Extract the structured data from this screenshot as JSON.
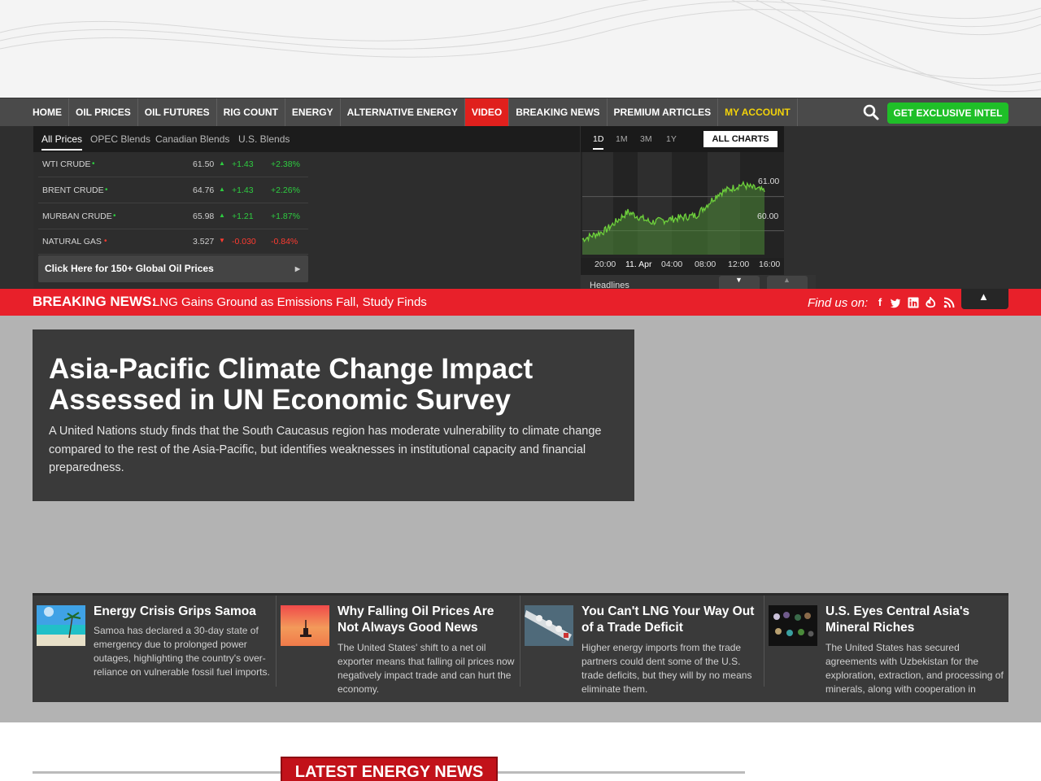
{
  "nav": {
    "items": [
      "HOME",
      "OIL PRICES",
      "OIL FUTURES",
      "RIG COUNT",
      "ENERGY",
      "ALTERNATIVE ENERGY",
      "VIDEO",
      "BREAKING NEWS",
      "PREMIUM ARTICLES",
      "MY ACCOUNT"
    ],
    "cta": "GET EXCLUSIVE INTEL"
  },
  "prices": {
    "tabs": [
      "All Prices",
      "OPEC Blends",
      "Canadian Blends",
      "U.S. Blends"
    ],
    "rows": [
      {
        "name": "WTI CRUDE",
        "last": "61.50",
        "change": "+1.43",
        "pct": "+2.38%",
        "dir": "up"
      },
      {
        "name": "BRENT CRUDE",
        "last": "64.76",
        "change": "+1.43",
        "pct": "+2.26%",
        "dir": "up"
      },
      {
        "name": "MURBAN CRUDE",
        "last": "65.98",
        "change": "+1.21",
        "pct": "+1.87%",
        "dir": "up"
      },
      {
        "name": "NATURAL GAS",
        "last": "3.527",
        "change": "-0.030",
        "pct": "-0.84%",
        "dir": "down"
      }
    ],
    "global_link": "Click Here for 150+ Global Oil Prices"
  },
  "chart": {
    "ranges": [
      "1D",
      "1M",
      "3M",
      "1Y"
    ],
    "all_charts": "ALL CHARTS",
    "y_ticks": [
      "61.00",
      "60.00"
    ],
    "x_labels": [
      "20:00",
      "11. Apr",
      "04:00",
      "08:00",
      "12:00",
      "16:00"
    ],
    "headlines_label": "Headlines"
  },
  "chart_data": {
    "type": "area",
    "x": [
      "20:00",
      "11. Apr",
      "04:00",
      "08:00",
      "12:00",
      "16:00"
    ],
    "series": [
      {
        "values": [
          59.75,
          60.0,
          60.55,
          60.25,
          60.35,
          60.45,
          61.1,
          61.35,
          61.15
        ]
      }
    ],
    "ylim": [
      59.3,
      62.3
    ]
  },
  "breaking": {
    "label": "BREAKING NEWS:",
    "headline": "LNG Gains Ground as Emissions Fall, Study Finds",
    "find_us": "Find us on:"
  },
  "hero": {
    "title": "Asia-Pacific Climate Change Impact Assessed in UN Economic Survey",
    "description": "A United Nations study finds that the South Caucasus region has moderate vulnerability to climate change compared to the rest of the Asia-Pacific, but identifies weaknesses in institutional capacity and financial preparedness."
  },
  "cards": [
    {
      "title": "Energy Crisis Grips Samoa",
      "description": "Samoa has declared a 30-day state of emergency due to prolonged power outages, highlighting the country's over-reliance on vulnerable fossil fuel imports."
    },
    {
      "title": "Why Falling Oil Prices Are Not Always Good News",
      "description": "The United States' shift to a net oil exporter means that falling oil prices now negatively impact trade and can hurt the economy."
    },
    {
      "title": "You Can't LNG Your Way Out of a Trade Deficit",
      "description": "Higher energy imports from the trade partners could dent some of the U.S. trade deficits, but they will by no means eliminate them."
    },
    {
      "title": "U.S. Eyes Central Asia's Mineral Riches",
      "description": "The United States has secured agreements with Uzbekistan for the exploration, extraction, and processing of minerals, along with cooperation in critical minerals supply chains."
    }
  ],
  "latest": {
    "label": "LATEST ENERGY NEWS"
  },
  "colors": {
    "accent_red": "#e8202a",
    "cta_green": "#1fbf28",
    "up": "#2ecc40",
    "down": "#ff3b30",
    "account_yellow": "#f2d20a"
  }
}
